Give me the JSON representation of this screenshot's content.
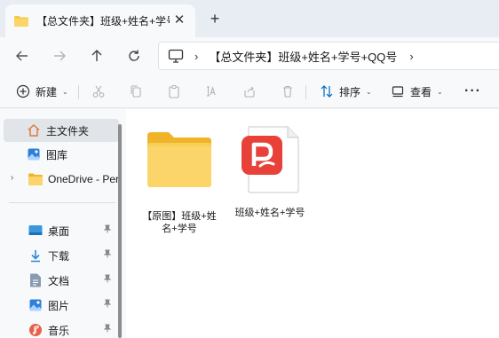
{
  "window": {
    "tab_title": "【总文件夹】班级+姓名+学号+QQ号",
    "close_glyph": "✕",
    "new_tab_glyph": "+"
  },
  "address": {
    "separator": "›",
    "crumb": "【总文件夹】班级+姓名+学号+QQ号",
    "trailing_separator": "›"
  },
  "toolbar": {
    "new_label": "新建",
    "sort_label": "排序",
    "view_label": "查看",
    "more_glyph": "···",
    "caret_glyph": "⌄"
  },
  "sidebar": {
    "items": [
      {
        "label": "主文件夹",
        "icon": "home-icon"
      },
      {
        "label": "图库",
        "icon": "gallery-icon"
      },
      {
        "label": "OneDrive - Pers",
        "icon": "folder-icon"
      },
      {
        "label": "桌面",
        "icon": "desktop-icon"
      },
      {
        "label": "下载",
        "icon": "download-icon"
      },
      {
        "label": "文档",
        "icon": "documents-icon"
      },
      {
        "label": "图片",
        "icon": "pictures-icon"
      },
      {
        "label": "音乐",
        "icon": "music-icon"
      }
    ],
    "pin_glyph": "📌",
    "expand_glyph": "›"
  },
  "files": [
    {
      "name": "【原图】班级+姓名+学号",
      "type": "folder"
    },
    {
      "name": "班级+姓名+学号",
      "type": "wps-pdf"
    }
  ],
  "colors": {
    "folder_yellow": "#f7c948",
    "folder_tab": "#f0b429",
    "pdf_red": "#e8413a",
    "accent": "#0067c0"
  }
}
